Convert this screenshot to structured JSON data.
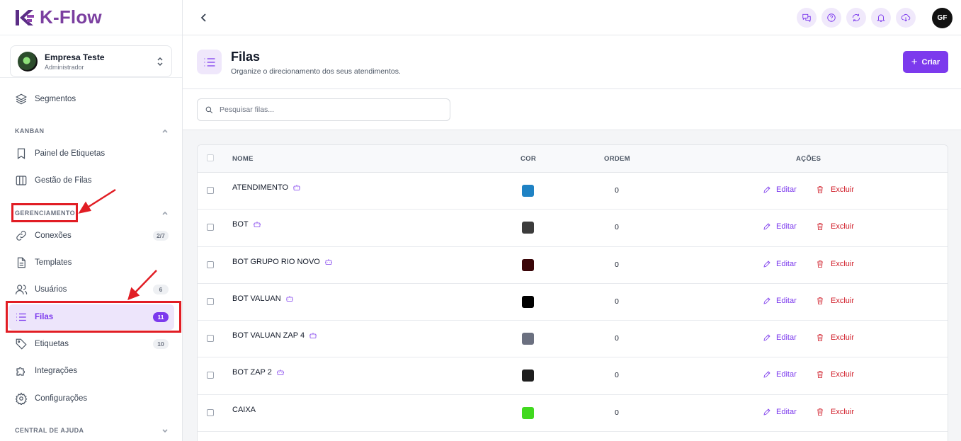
{
  "app": {
    "logo_text": "K-Flow"
  },
  "org": {
    "name": "Empresa Teste",
    "role": "Administrador"
  },
  "sidebar": {
    "segmentos": "Segmentos",
    "kanban_header": "KANBAN",
    "painel": "Painel de Etiquetas",
    "gestao": "Gestão de Filas",
    "gerenciamento_header": "GERENCIAMENTO",
    "conexoes": {
      "label": "Conexões",
      "badge": "2/7"
    },
    "templates": "Templates",
    "usuarios": {
      "label": "Usuários",
      "badge": "6"
    },
    "filas": {
      "label": "Filas",
      "badge": "11"
    },
    "etiquetas": {
      "label": "Etiquetas",
      "badge": "10"
    },
    "integracoes": "Integrações",
    "configuracoes": "Configurações",
    "ajuda_header": "CENTRAL DE AJUDA"
  },
  "topbar": {
    "avatar": "GF"
  },
  "page": {
    "title": "Filas",
    "subtitle": "Organize o direcionamento dos seus atendimentos.",
    "create_label": "Criar"
  },
  "search": {
    "placeholder": "Pesquisar filas..."
  },
  "table": {
    "headers": {
      "nome": "NOME",
      "cor": "COR",
      "ordem": "ORDEM",
      "acoes": "AÇÕES"
    },
    "edit_label": "Editar",
    "delete_label": "Excluir",
    "rows": [
      {
        "name": "ATENDIMENTO",
        "bot": true,
        "color": "#1f82c4",
        "ordem": "0"
      },
      {
        "name": "BOT",
        "bot": true,
        "color": "#3c3c3c",
        "ordem": "0"
      },
      {
        "name": "BOT GRUPO RIO NOVO",
        "bot": true,
        "color": "#3a0508",
        "ordem": "0"
      },
      {
        "name": "BOT VALUAN",
        "bot": true,
        "color": "#000000",
        "ordem": "0"
      },
      {
        "name": "BOT VALUAN ZAP 4",
        "bot": true,
        "color": "#6b7080",
        "ordem": "0"
      },
      {
        "name": "BOT ZAP 2",
        "bot": true,
        "color": "#1e1e1e",
        "ordem": "0"
      },
      {
        "name": "CAIXA",
        "bot": false,
        "color": "#41d91f",
        "ordem": "0"
      }
    ]
  },
  "colors": {
    "accent": "#7c3aed",
    "danger": "#d01c28",
    "annotation": "#e11d24"
  }
}
